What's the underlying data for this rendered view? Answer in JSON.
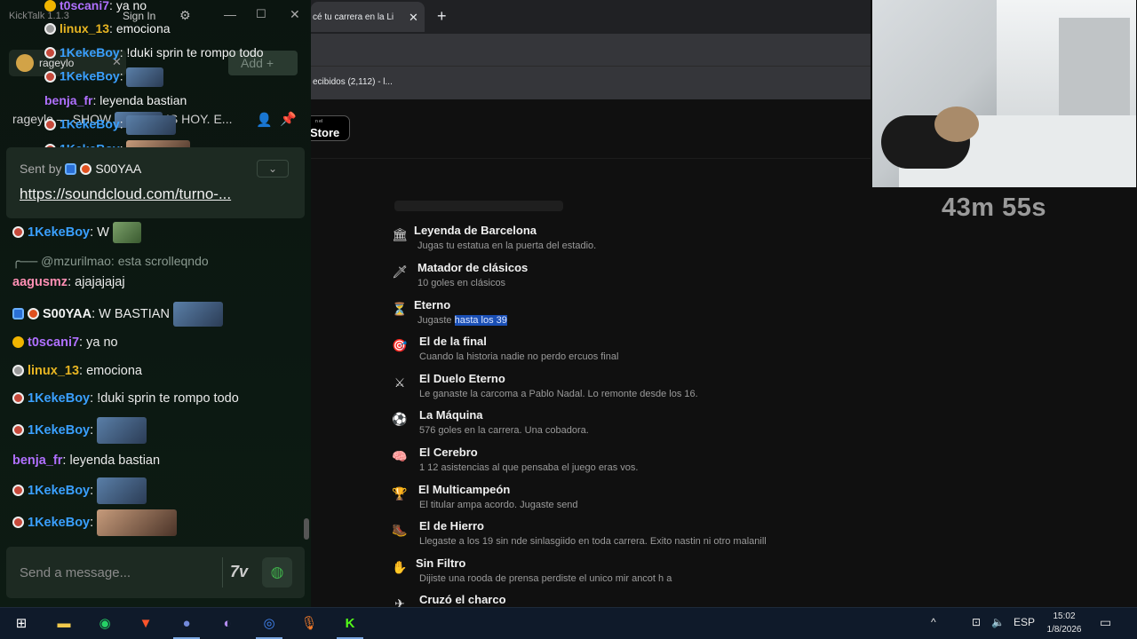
{
  "app": {
    "title": "KickTalk 1.1.3",
    "sign_in": "Sign In",
    "channel_tab": "rageylo",
    "add_button": "Add",
    "add_plus": "+",
    "pinned_header": "rageylo — SHOW",
    "pinned_header_tail": "IS HOY. E..."
  },
  "overlay_messages": [
    {
      "user": "t0scani7",
      "text": "ya no",
      "color": "gold"
    },
    {
      "user": "linux_13",
      "text": "emociona",
      "color": "gold"
    },
    {
      "user": "1KekeBoy",
      "text": "!duki sprin te rompo todo",
      "color": "blue"
    },
    {
      "user": "1KekeBoy",
      "text": "",
      "color": "blue"
    },
    {
      "user": "benja_fr",
      "text": "leyenda bastian",
      "color": "purple"
    },
    {
      "user": "1KekeBoy",
      "text": "",
      "color": "blue"
    },
    {
      "user": "1KekeBoy",
      "text": "",
      "color": "blue"
    }
  ],
  "pinned": {
    "sent_by_label": "Sent by",
    "sent_by_user": "S00YAA",
    "link": "https://soundcloud.com/turno-..."
  },
  "messages": [
    {
      "user": "1KekeBoy",
      "text": "W"
    },
    {
      "reply_to": "@mzurilmao: esta scrolleqndo"
    },
    {
      "user": "aagusmz",
      "text": "ajajajajaj"
    },
    {
      "user": "S00YAA",
      "text": "W BASTIAN"
    },
    {
      "user": "t0scani7",
      "text": "ya no"
    },
    {
      "user": "linux_13",
      "text": "emociona"
    },
    {
      "user": "1KekeBoy",
      "text": "!duki sprin te rompo todo"
    },
    {
      "user": "1KekeBoy",
      "text": ""
    },
    {
      "user": "benja_fr",
      "text": "leyenda bastian"
    },
    {
      "user": "1KekeBoy",
      "text": ""
    },
    {
      "user": "1KekeBoy",
      "text": ""
    }
  ],
  "input": {
    "placeholder": "Send a message..."
  },
  "browser": {
    "tab_title": "cé tu carrera en la Li",
    "tab_close": "✕",
    "new_tab": "+",
    "bookmark": "ecibidos (2,112) - l...",
    "store_small": "n el",
    "store_label": "Store"
  },
  "achievements": [
    {
      "title": "Leyenda de Barcelona",
      "desc": "Jugas tu estatua en la puerta del estadio.",
      "icon": "🏛"
    },
    {
      "title": "Matador de clásicos",
      "desc": "10 goles en clásicos",
      "icon": "🗡"
    },
    {
      "title": "Eterno",
      "desc_a": "Jugaste ",
      "desc_b": "hasta los 39",
      "icon": "⏳"
    },
    {
      "title": "El de la final",
      "desc": "Cuando la historia nadie no perdo ercuos final",
      "icon": "🎯"
    },
    {
      "title": "El Duelo Eterno",
      "desc": "Le ganaste la carcoma a Pablo Nadal. Lo remonte desde los 16.",
      "icon": "⚔"
    },
    {
      "title": "La Máquina",
      "desc": "576 goles en la carrera. Una cobadora.",
      "icon": "⚽"
    },
    {
      "title": "El Cerebro",
      "desc": "1 12 asistencias al que pensaba el juego eras vos.",
      "icon": "🧠"
    },
    {
      "title": "El Multicampeón",
      "desc": "El titular ampa acordo. Jugaste send",
      "icon": "🏆"
    },
    {
      "title": "El de Hierro",
      "desc": "Llegaste a los 19 sin nde sinlasgiido en toda carrera. Exito nastin ni otro malanill",
      "icon": "🥾"
    },
    {
      "title": "Sin Filtro",
      "desc": "Dijiste una rooda de prensa perdiste el unico mir ancot h a",
      "icon": "✋"
    },
    {
      "title": "Cruzó el charco",
      "desc": "",
      "icon": "✈"
    }
  ],
  "stream": {
    "timer": "43m 55s"
  },
  "taskbar": {
    "lang": "ESP",
    "time": "15:02",
    "date": "1/8/2026"
  }
}
